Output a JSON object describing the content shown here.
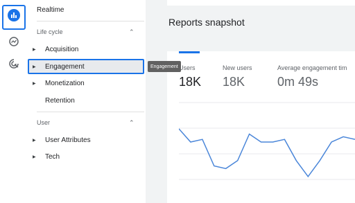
{
  "nav": {
    "realtime": "Realtime",
    "sections": [
      {
        "label": "Life cycle",
        "items": [
          "Acquisition",
          "Engagement",
          "Monetization",
          "Retention"
        ]
      },
      {
        "label": "User",
        "items": [
          "User Attributes",
          "Tech"
        ]
      }
    ],
    "selected": "Engagement"
  },
  "tooltip": "Engagement",
  "main": {
    "title": "Reports snapshot",
    "metrics": [
      {
        "label": "Users",
        "value": "18K"
      },
      {
        "label": "New users",
        "value": "18K"
      },
      {
        "label": "Average engagement tim",
        "value": "0m 49s"
      }
    ]
  },
  "chart_data": {
    "type": "line",
    "series": [
      {
        "values": [
          68,
          63,
          64,
          54,
          53,
          56,
          66,
          63,
          63,
          64,
          56,
          50,
          56,
          63,
          65,
          64
        ]
      }
    ],
    "ylim": [
      40,
      80
    ],
    "grid": true
  },
  "colors": {
    "accent": "#1a73e8",
    "line": "#4a86d9"
  }
}
